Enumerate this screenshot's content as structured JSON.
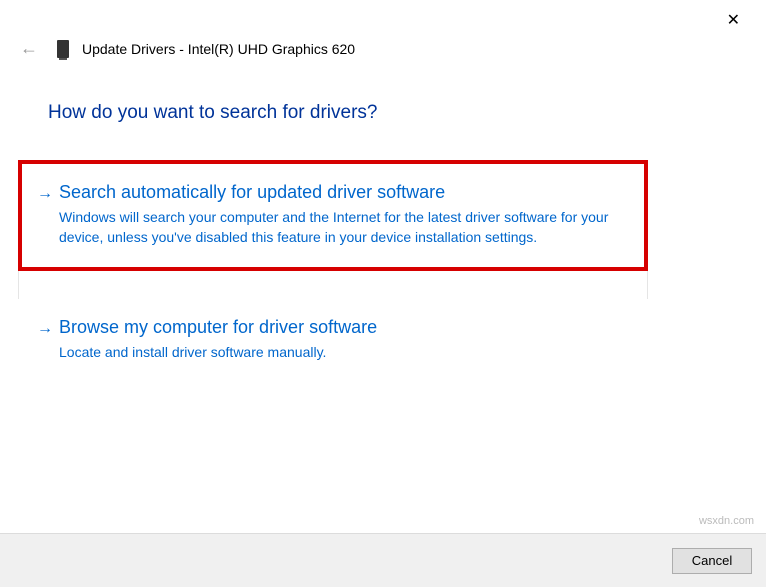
{
  "window": {
    "title": "Update Drivers - Intel(R) UHD Graphics 620"
  },
  "question": "How do you want to search for drivers?",
  "options": {
    "auto": {
      "title": "Search automatically for updated driver software",
      "desc": "Windows will search your computer and the Internet for the latest driver software for your device, unless you've disabled this feature in your device installation settings."
    },
    "browse": {
      "title": "Browse my computer for driver software",
      "desc": "Locate and install driver software manually."
    }
  },
  "buttons": {
    "cancel": "Cancel"
  },
  "watermark": "wsxdn.com"
}
